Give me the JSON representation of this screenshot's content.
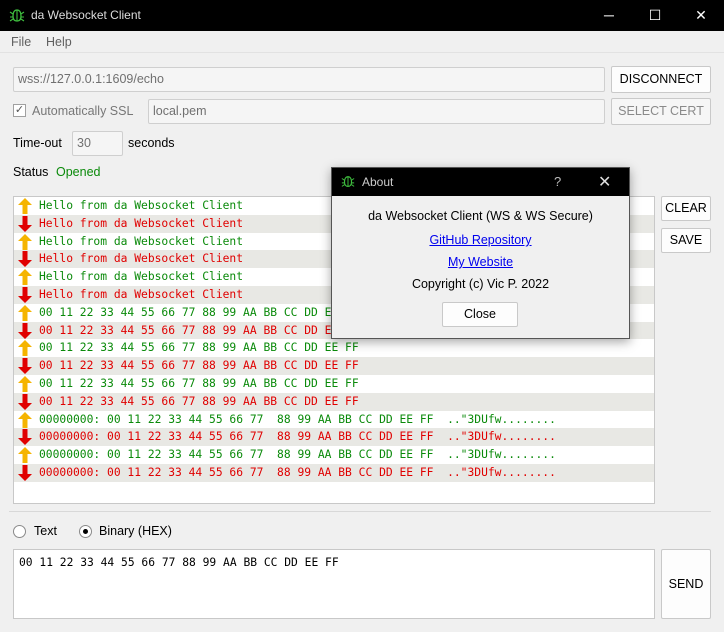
{
  "window": {
    "title": "da Websocket Client",
    "minimize_icon": "minimize-icon",
    "maximize_icon": "maximize-icon",
    "close_icon": "close-icon",
    "minimize_glyph": "─",
    "maximize_glyph": "☐",
    "close_glyph": "✕"
  },
  "menu": [
    "File",
    "Help"
  ],
  "connection": {
    "url": "wss://127.0.0.1:1609/echo",
    "disconnect_label": "DISCONNECT",
    "auto_ssl_label": "Automatically SSL",
    "auto_ssl_checked": true,
    "cert_value": "local.pem",
    "select_cert_label": "SELECT CERT",
    "timeout_label": "Time-out",
    "timeout_value": "30",
    "timeout_unit": "seconds",
    "status_label": "Status",
    "status_value": "Opened",
    "status_color": "#0a8a0a"
  },
  "log": {
    "sent_color": "#0a8a0a",
    "recv_color": "#e00000",
    "sent_arrow_color": "#f5b400",
    "recv_arrow_color": "#e00000",
    "rows": [
      {
        "dir": "sent",
        "text": "Hello from da Websocket Client"
      },
      {
        "dir": "recv",
        "text": "Hello from da Websocket Client"
      },
      {
        "dir": "sent",
        "text": "Hello from da Websocket Client"
      },
      {
        "dir": "recv",
        "text": "Hello from da Websocket Client"
      },
      {
        "dir": "sent",
        "text": "Hello from da Websocket Client"
      },
      {
        "dir": "recv",
        "text": "Hello from da Websocket Client"
      },
      {
        "dir": "sent",
        "text": "00 11 22 33 44 55 66 77 88 99 AA BB CC DD EE FF"
      },
      {
        "dir": "recv",
        "text": "00 11 22 33 44 55 66 77 88 99 AA BB CC DD EE FF"
      },
      {
        "dir": "sent",
        "text": "00 11 22 33 44 55 66 77 88 99 AA BB CC DD EE FF"
      },
      {
        "dir": "recv",
        "text": "00 11 22 33 44 55 66 77 88 99 AA BB CC DD EE FF"
      },
      {
        "dir": "sent",
        "text": "00 11 22 33 44 55 66 77 88 99 AA BB CC DD EE FF"
      },
      {
        "dir": "recv",
        "text": "00 11 22 33 44 55 66 77 88 99 AA BB CC DD EE FF"
      },
      {
        "dir": "sent",
        "text": "00000000: 00 11 22 33 44 55 66 77  88 99 AA BB CC DD EE FF  ..\"3DUfw........"
      },
      {
        "dir": "recv",
        "text": "00000000: 00 11 22 33 44 55 66 77  88 99 AA BB CC DD EE FF  ..\"3DUfw........"
      },
      {
        "dir": "sent",
        "text": "00000000: 00 11 22 33 44 55 66 77  88 99 AA BB CC DD EE FF  ..\"3DUfw........"
      },
      {
        "dir": "recv",
        "text": "00000000: 00 11 22 33 44 55 66 77  88 99 AA BB CC DD EE FF  ..\"3DUfw........"
      }
    ]
  },
  "side_buttons": {
    "clear_label": "CLEAR",
    "save_label": "SAVE"
  },
  "mode": {
    "text_label": "Text",
    "binary_label": "Binary (HEX)",
    "selected": "binary"
  },
  "compose": {
    "value": "00 11 22 33 44 55 66 77 88 99 AA BB CC DD EE FF",
    "send_label": "SEND"
  },
  "about_dialog": {
    "title": "About",
    "help_glyph": "?",
    "close_glyph": "✕",
    "app_line": "da Websocket Client (WS & WS Secure)",
    "github_link": "GitHub Repository",
    "website_link": "My Website",
    "copyright": "Copyright (c) Vic P. 2022",
    "close_label": "Close"
  }
}
